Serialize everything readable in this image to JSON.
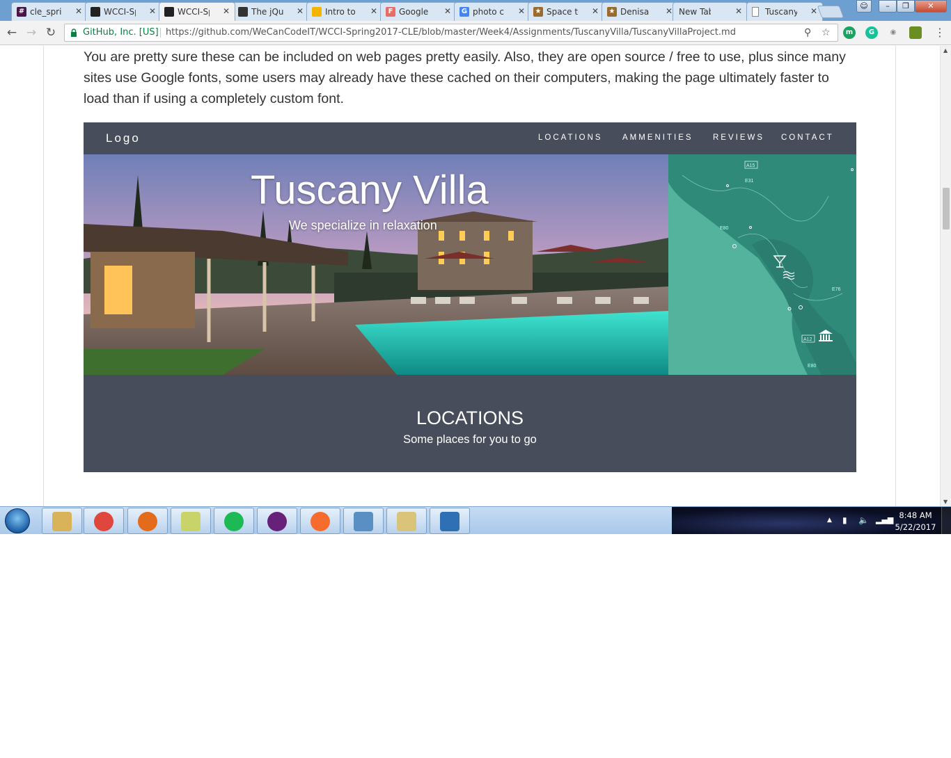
{
  "browser": {
    "tabs": [
      {
        "title": "cle_sprin",
        "icon": "slack-icon",
        "color": "#4a154b",
        "glyph": "#"
      },
      {
        "title": "WCCI-Sp",
        "icon": "github-icon",
        "color": "#222222",
        "glyph": ""
      },
      {
        "title": "WCCI-Sp",
        "icon": "github-icon",
        "color": "#222222",
        "glyph": "",
        "active": true
      },
      {
        "title": "The jQu",
        "icon": "jquery-icon",
        "color": "#333333",
        "glyph": ""
      },
      {
        "title": "Intro to j",
        "icon": "slides-icon",
        "color": "#f4b400",
        "glyph": ""
      },
      {
        "title": "Google I",
        "icon": "google-fonts-icon",
        "color": "#e66e66",
        "glyph": "F"
      },
      {
        "title": "photo cr",
        "icon": "google-icon",
        "color": "#4285f4",
        "glyph": "G"
      },
      {
        "title": "Space to",
        "icon": "star-icon",
        "color": "#9a6b2a",
        "glyph": "★"
      },
      {
        "title": "Denisa I",
        "icon": "star-icon",
        "color": "#9a6b2a",
        "glyph": "★"
      },
      {
        "title": "New Tab",
        "icon": "",
        "color": "",
        "glyph": ""
      },
      {
        "title": "Tuscany",
        "icon": "page-icon",
        "color": "#ffffff",
        "glyph": ""
      }
    ],
    "ev_label": "GitHub, Inc. [US]",
    "url": "https://github.com/WeCanCodeIT/WCCI-Spring2017-CLE/blob/master/Week4/Assignments/TuscanyVilla/TuscanyVillaProject.md"
  },
  "page": {
    "paragraph": "You are pretty sure these can be included on web pages pretty easily. Also, they are open source / free to use, plus since many sites use Google fonts, some users may already have these cached on their computers, making the page ultimately faster to load than if using a completely custom font."
  },
  "mockup": {
    "logo": "Logo",
    "nav": [
      "LOCATIONS",
      "AMMENITIES",
      "REVIEWS",
      "CONTACT"
    ],
    "hero_title": "Tuscany Villa",
    "hero_subtitle": "We specialize in relaxation",
    "map_labels": [
      "A15",
      "E31",
      "E80",
      "E76",
      "A12",
      "E80"
    ],
    "section_title": "LOCATIONS",
    "section_subtitle": "Some places for you to go"
  },
  "taskbar": {
    "time": "8:48 AM",
    "date": "5/22/2017",
    "apps": [
      "file-explorer-icon",
      "chrome-icon",
      "firefox-icon",
      "sticky-notes-icon",
      "spotify-icon",
      "visual-studio-icon",
      "origin-icon",
      "snipping-tool-icon",
      "paint-icon",
      "photo-viewer-icon"
    ]
  }
}
